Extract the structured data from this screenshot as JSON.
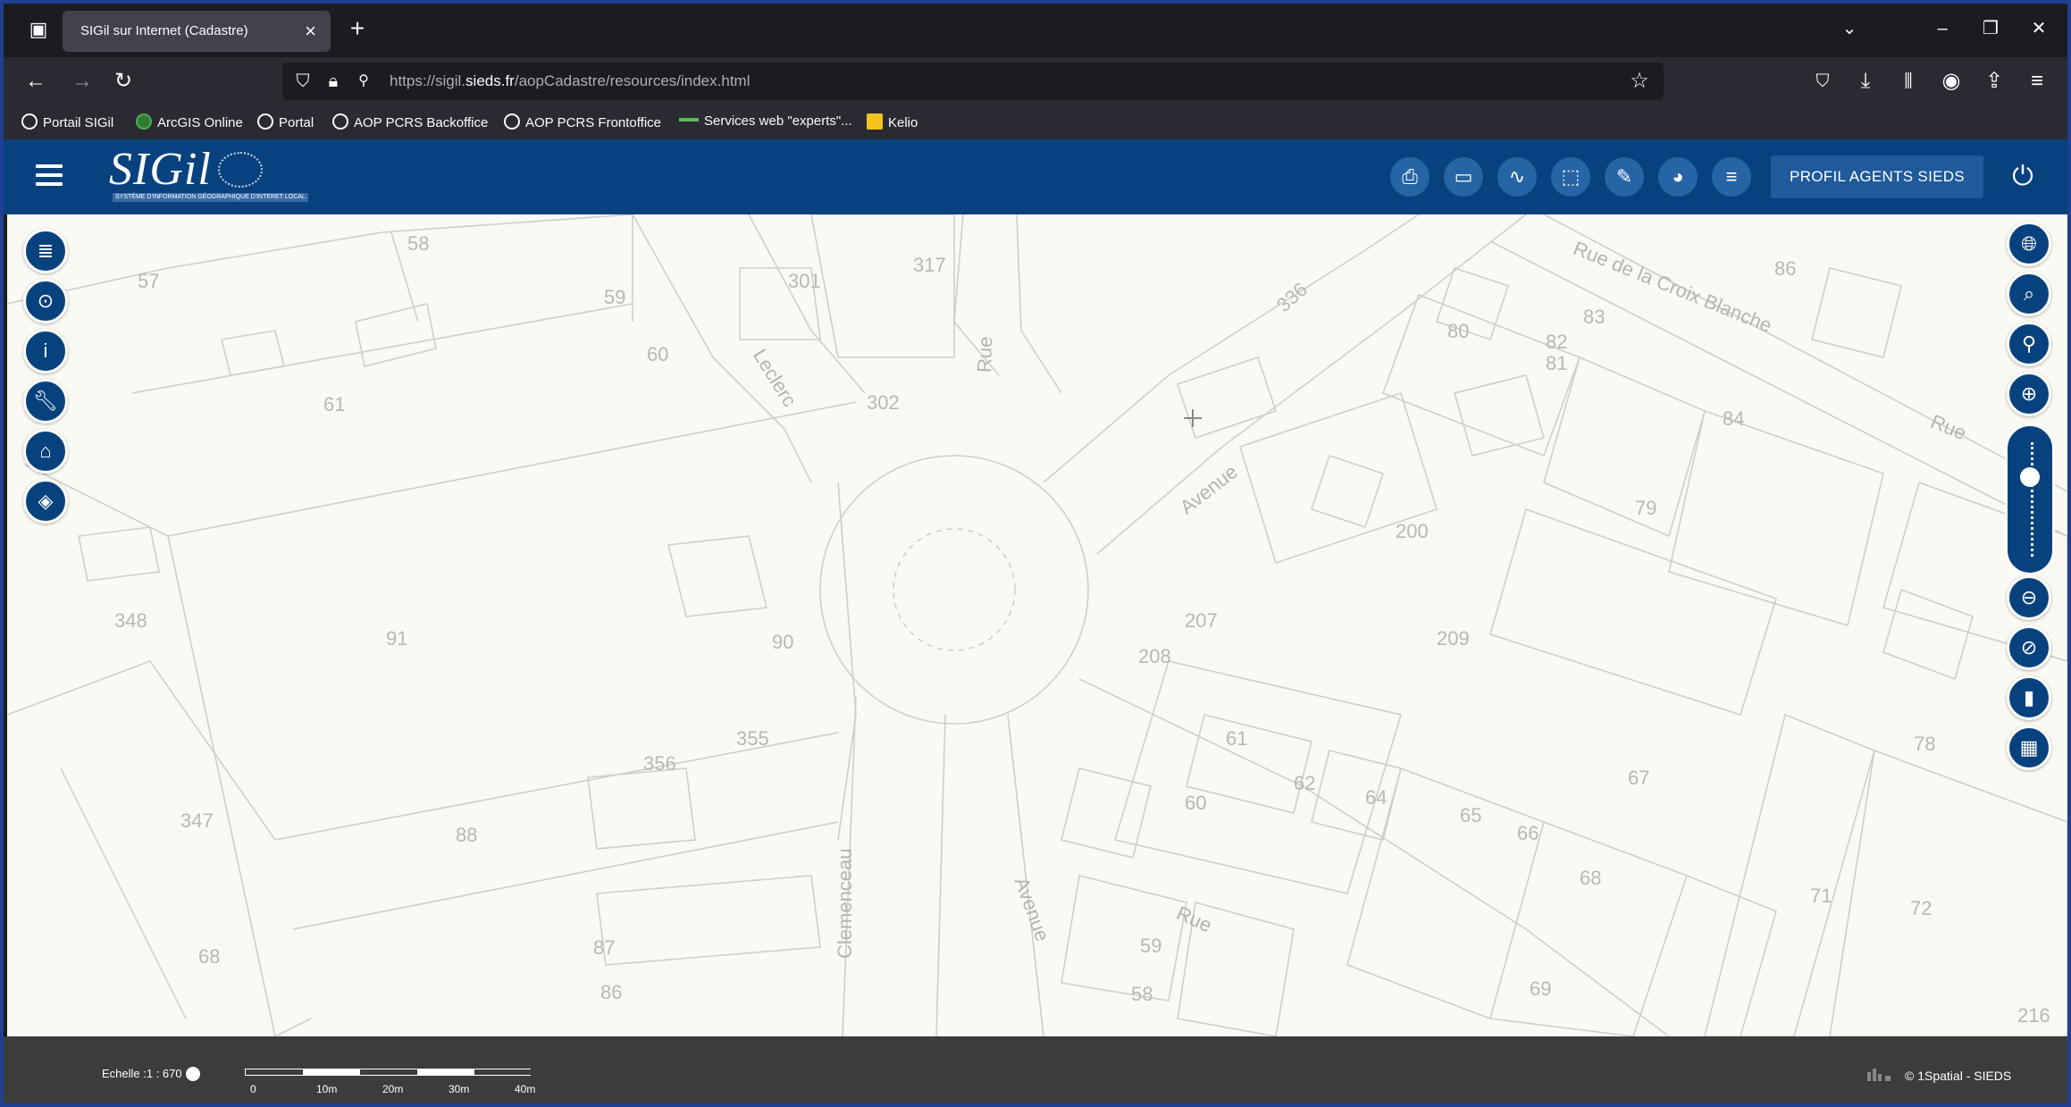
{
  "browser": {
    "tab_title": "SIGil sur Internet (Cadastre)",
    "url_prefix": "https://sigil.",
    "url_domain": "sieds.fr",
    "url_path": "/aopCadastre/resources/index.html",
    "bookmarks": [
      "Portail SIGil",
      "ArcGIS Online",
      "Portal",
      "AOP PCRS Backoffice",
      "AOP PCRS Frontoffice",
      "Services web \"experts\"...",
      "Kelio"
    ]
  },
  "app": {
    "logo_text": "SIGil",
    "logo_sub": "SYSTÈME D'INFORMATION GÉOGRAPHIQUE D'INTERET LOCAL",
    "profile_label": "PROFIL AGENTS SIEDS",
    "brand_color": "#07427e"
  },
  "map": {
    "parcels": [
      "58",
      "57",
      "59",
      "301",
      "317",
      "60",
      "302",
      "61",
      "91",
      "90",
      "348",
      "355",
      "356",
      "347",
      "88",
      "68",
      "87",
      "86",
      "336",
      "80",
      "82",
      "81",
      "83",
      "86",
      "84",
      "79",
      "200",
      "207",
      "208",
      "209",
      "61",
      "62",
      "60",
      "64",
      "65",
      "66",
      "67",
      "68",
      "69",
      "59",
      "58",
      "78",
      "71",
      "72",
      "216"
    ],
    "streets": [
      "Leclerc",
      "Rue",
      "Avenue",
      "Rue de la Croix Blanche",
      "Rue",
      "Clemenceau",
      "Avenue",
      "Rue"
    ]
  },
  "status": {
    "scale_label": "Echelle :1 : 670",
    "ticks": [
      "0",
      "10m",
      "20m",
      "30m",
      "40m"
    ],
    "credit": "© 1Spatial - SIEDS"
  }
}
